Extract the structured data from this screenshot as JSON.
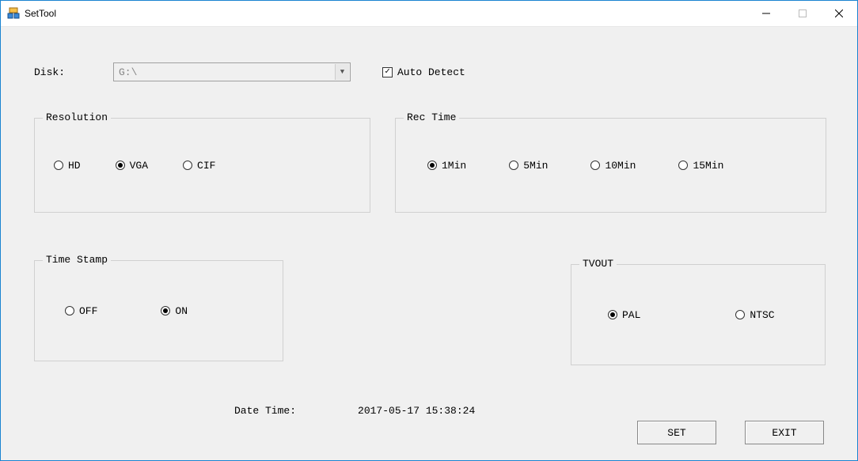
{
  "window": {
    "title": "SetTool"
  },
  "disk": {
    "label": "Disk:",
    "value": "G:\\"
  },
  "auto_detect": {
    "label": "Auto Detect",
    "checked": true
  },
  "resolution": {
    "legend": "Resolution",
    "options": {
      "hd": "HD",
      "vga": "VGA",
      "cif": "CIF"
    },
    "selected": "vga"
  },
  "rectime": {
    "legend": "Rec Time",
    "options": {
      "m1": "1Min",
      "m5": "5Min",
      "m10": "10Min",
      "m15": "15Min"
    },
    "selected": "m1"
  },
  "timestamp": {
    "legend": "Time Stamp",
    "options": {
      "off": "OFF",
      "on": "ON"
    },
    "selected": "on"
  },
  "tvout": {
    "legend": "TVOUT",
    "options": {
      "pal": "PAL",
      "ntsc": "NTSC"
    },
    "selected": "pal"
  },
  "datetime": {
    "label": "Date Time:",
    "value": "2017-05-17 15:38:24"
  },
  "buttons": {
    "set": "SET",
    "exit": "EXIT"
  }
}
